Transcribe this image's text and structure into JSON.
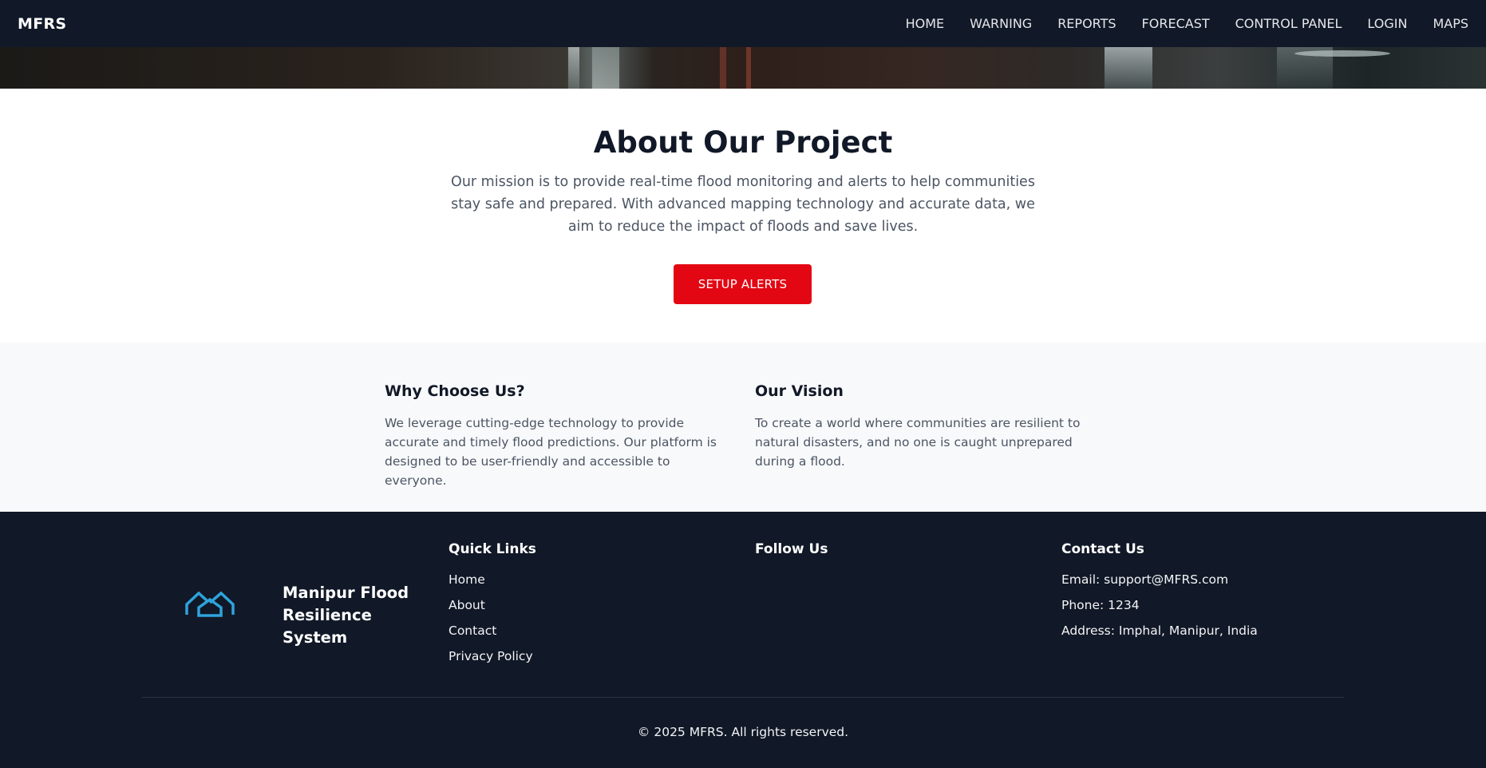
{
  "nav": {
    "brand": "MFRS",
    "links": [
      "HOME",
      "WARNING",
      "REPORTS",
      "FORECAST",
      "CONTROL PANEL",
      "LOGIN",
      "MAPS"
    ]
  },
  "about": {
    "title": "About Our Project",
    "text": "Our mission is to provide real-time flood monitoring and alerts to help communities stay safe and prepared. With advanced mapping technology and accurate data, we aim to reduce the impact of floods and save lives.",
    "button_label": "SETUP ALERTS",
    "button_color": "#e30613"
  },
  "features": [
    {
      "title": "Why Choose Us?",
      "text": "We leverage cutting-edge technology to provide accurate and timely flood predictions. Our platform is designed to be user-friendly and accessible to everyone."
    },
    {
      "title": "Our Vision",
      "text": "To create a world where communities are resilient to natural disasters, and no one is caught unprepared during a flood."
    }
  ],
  "footer": {
    "logo_icon": "house-outline-icon",
    "logo_color": "#2ea3db",
    "brand": "Manipur Flood Resilience System",
    "quick_links": {
      "title": "Quick Links",
      "items": [
        "Home",
        "About",
        "Contact",
        "Privacy Policy"
      ]
    },
    "follow": {
      "title": "Follow Us"
    },
    "contact": {
      "title": "Contact Us",
      "email": "Email: support@MFRS.com",
      "phone": "Phone: 1234",
      "address": "Address: Imphal, Manipur, India"
    },
    "copyright": "© 2025 MFRS. All rights reserved."
  },
  "colors": {
    "dark": "#111827",
    "accent_red": "#e30613",
    "light_bg": "#f8f9fb"
  }
}
